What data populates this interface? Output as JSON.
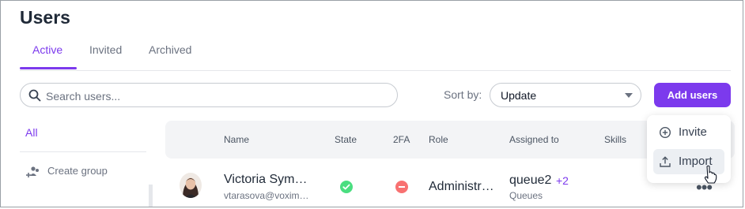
{
  "page": {
    "title": "Users"
  },
  "tabs": [
    {
      "label": "Active",
      "active": true
    },
    {
      "label": "Invited",
      "active": false
    },
    {
      "label": "Archived",
      "active": false
    }
  ],
  "search": {
    "placeholder": "Search users...",
    "value": ""
  },
  "sort": {
    "label": "Sort by:",
    "value": "Update"
  },
  "actions": {
    "add_users": "Add users"
  },
  "add_menu": {
    "items": [
      {
        "label": "Invite",
        "icon": "plus-circle-icon"
      },
      {
        "label": "Import",
        "icon": "upload-icon"
      }
    ]
  },
  "sidebar": {
    "all": "All",
    "create_group": "Create group"
  },
  "table": {
    "columns": [
      "Name",
      "State",
      "2FA",
      "Role",
      "Assigned to",
      "Skills"
    ],
    "rows": [
      {
        "name": "Victoria Sym…",
        "email": "vtarasova@voxim…",
        "state": "active",
        "twofa": "disabled",
        "role": "Administr…",
        "assigned": "queue2",
        "assigned_more": "+2",
        "assigned_type": "Queues"
      }
    ]
  },
  "colors": {
    "accent": "#7c3aed",
    "success": "#4ade80",
    "danger": "#f87171"
  }
}
